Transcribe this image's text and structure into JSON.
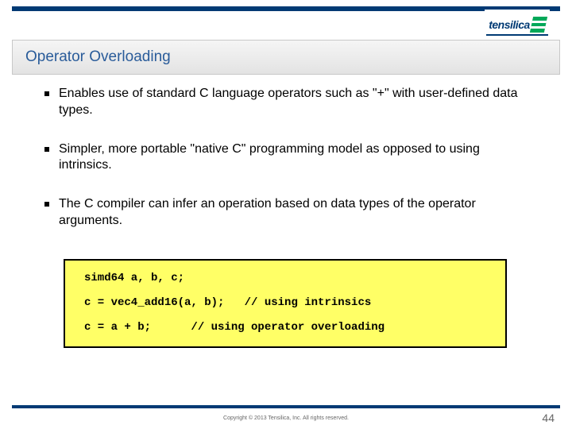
{
  "brand": "tensilica",
  "title": "Operator Overloading",
  "bullets": [
    "Enables use of standard C language operators such as \"+\" with user-defined data types.",
    "Simpler, more portable \"native C\" programming model as opposed to using intrinsics.",
    "The C compiler can infer an operation based on data types of the operator arguments."
  ],
  "code": [
    "simd64 a, b, c;",
    "c = vec4_add16(a, b);   // using intrinsics",
    "c = a + b;      // using operator overloading"
  ],
  "copyright": "Copyright © 2013  Tensilica, Inc. All rights reserved.",
  "page": "44"
}
